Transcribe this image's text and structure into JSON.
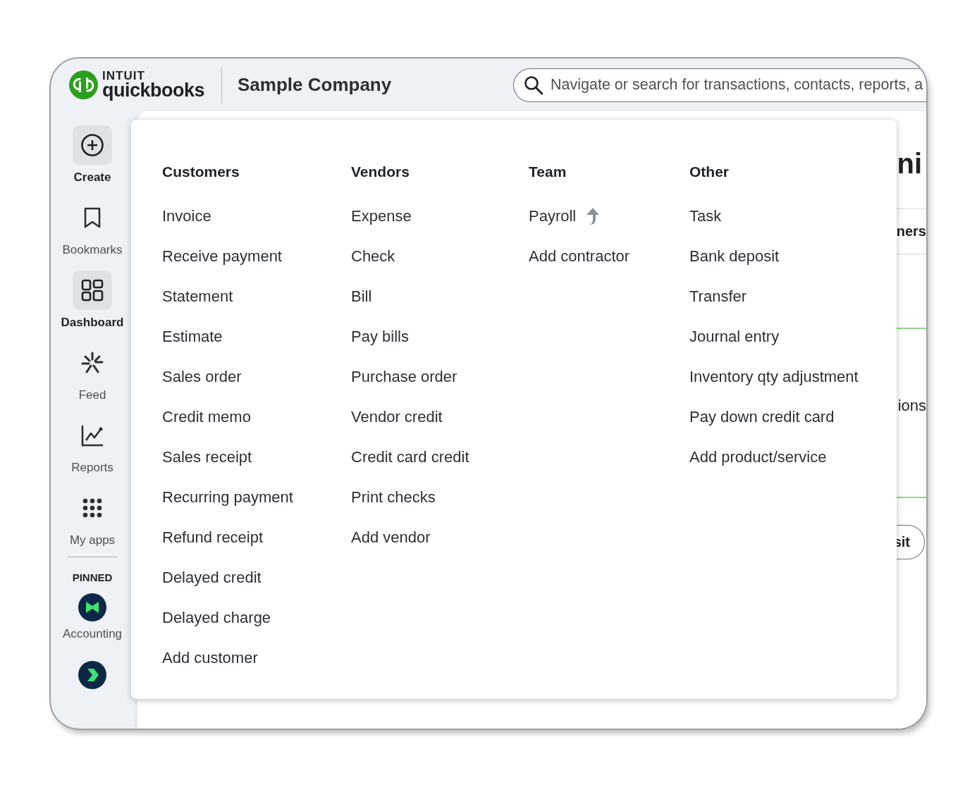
{
  "header": {
    "brand_top": "INTUIT",
    "brand_name": "quickbooks",
    "company": "Sample Company",
    "search": {
      "placeholder": "Navigate or search for transactions, contacts, reports, a"
    }
  },
  "sidebar": {
    "items": [
      {
        "kind": "action",
        "label": "Create"
      },
      {
        "kind": "nav",
        "label": "Bookmarks",
        "selected": false
      },
      {
        "kind": "nav",
        "label": "Dashboard",
        "selected": true
      },
      {
        "kind": "nav",
        "label": "Feed",
        "selected": false
      },
      {
        "kind": "nav",
        "label": "Reports",
        "selected": false
      },
      {
        "kind": "nav",
        "label": "My apps",
        "selected": false
      }
    ],
    "pinned_heading": "PINNED",
    "pinned": [
      {
        "kind": "app",
        "label": "Accounting"
      },
      {
        "kind": "app"
      }
    ]
  },
  "background_page": {
    "heading": "ni",
    "tab": "ners",
    "text": "ions",
    "button": "sit"
  },
  "create_menu": {
    "columns": [
      {
        "heading": "Customers",
        "items": [
          {
            "label": "Invoice"
          },
          {
            "label": "Receive payment"
          },
          {
            "label": "Statement"
          },
          {
            "label": "Estimate"
          },
          {
            "label": "Sales order"
          },
          {
            "label": "Credit memo"
          },
          {
            "label": "Sales receipt"
          },
          {
            "label": "Recurring payment"
          },
          {
            "label": "Refund receipt"
          },
          {
            "label": "Delayed credit"
          },
          {
            "label": "Delayed charge"
          },
          {
            "label": "Add customer"
          }
        ]
      },
      {
        "heading": "Vendors",
        "items": [
          {
            "label": "Expense"
          },
          {
            "label": "Check"
          },
          {
            "label": "Bill"
          },
          {
            "label": "Pay bills"
          },
          {
            "label": "Purchase order"
          },
          {
            "label": "Vendor credit"
          },
          {
            "label": "Credit card credit"
          },
          {
            "label": "Print checks"
          },
          {
            "label": "Add vendor"
          }
        ]
      },
      {
        "heading": "Team",
        "items": [
          {
            "label": "Payroll",
            "upgrade": true
          },
          {
            "label": "Add contractor"
          }
        ]
      },
      {
        "heading": "Other",
        "items": [
          {
            "label": "Task"
          },
          {
            "label": "Bank deposit"
          },
          {
            "label": "Transfer"
          },
          {
            "label": "Journal entry"
          },
          {
            "label": "Inventory qty adjustment"
          },
          {
            "label": "Pay down credit card"
          },
          {
            "label": "Add product/service"
          }
        ]
      }
    ]
  }
}
